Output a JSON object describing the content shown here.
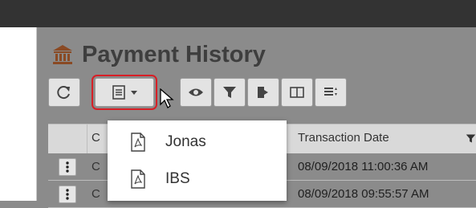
{
  "page": {
    "title": "Payment History"
  },
  "toolbar": {
    "buttons": [
      {
        "name": "refresh-button",
        "icon": "refresh-icon"
      },
      {
        "name": "export-menu-button",
        "icon": "document-list-icon"
      },
      {
        "name": "view-button",
        "icon": "eye-icon"
      },
      {
        "name": "filter-button",
        "icon": "filter-icon"
      },
      {
        "name": "export-file-button",
        "icon": "export-door-icon"
      },
      {
        "name": "columns-button",
        "icon": "columns-icon"
      },
      {
        "name": "sort-button",
        "icon": "sort-lines-icon"
      }
    ]
  },
  "grid": {
    "columns": {
      "second_col_prefix": "C",
      "transaction_date": "Transaction Date"
    },
    "rows": [
      {
        "prefix": "C",
        "date": "08/09/2018 11:00:36 AM"
      },
      {
        "prefix": "C",
        "date": "08/09/2018 09:55:57 AM"
      }
    ]
  },
  "export_menu": {
    "items": [
      {
        "label": "Jonas",
        "icon": "pdf-icon"
      },
      {
        "label": "IBS",
        "icon": "pdf-icon"
      }
    ]
  },
  "colors": {
    "overlay_gray": "#8b8b8b",
    "topbar": "#333333",
    "highlight_border": "#d71f26",
    "title_text": "#3e3e3e"
  }
}
